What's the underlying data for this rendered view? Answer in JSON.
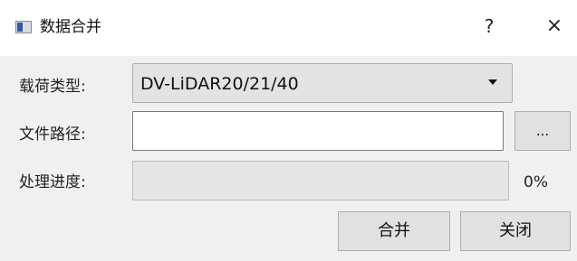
{
  "window": {
    "title": "数据合并",
    "help_label": "?",
    "close_label": "×"
  },
  "form": {
    "payload_type_label": "载荷类型:",
    "payload_type_value": "DV-LiDAR20/21/40",
    "file_path_label": "文件路径:",
    "file_path_value": "",
    "browse_label": "...",
    "progress_label": "处理进度:",
    "progress_value": 0,
    "progress_text": "0%"
  },
  "buttons": {
    "merge_label": "合并",
    "close_label": "关闭"
  },
  "colors": {
    "dialog_background": "#f0f0f0",
    "progress_fill": "#06b025"
  }
}
